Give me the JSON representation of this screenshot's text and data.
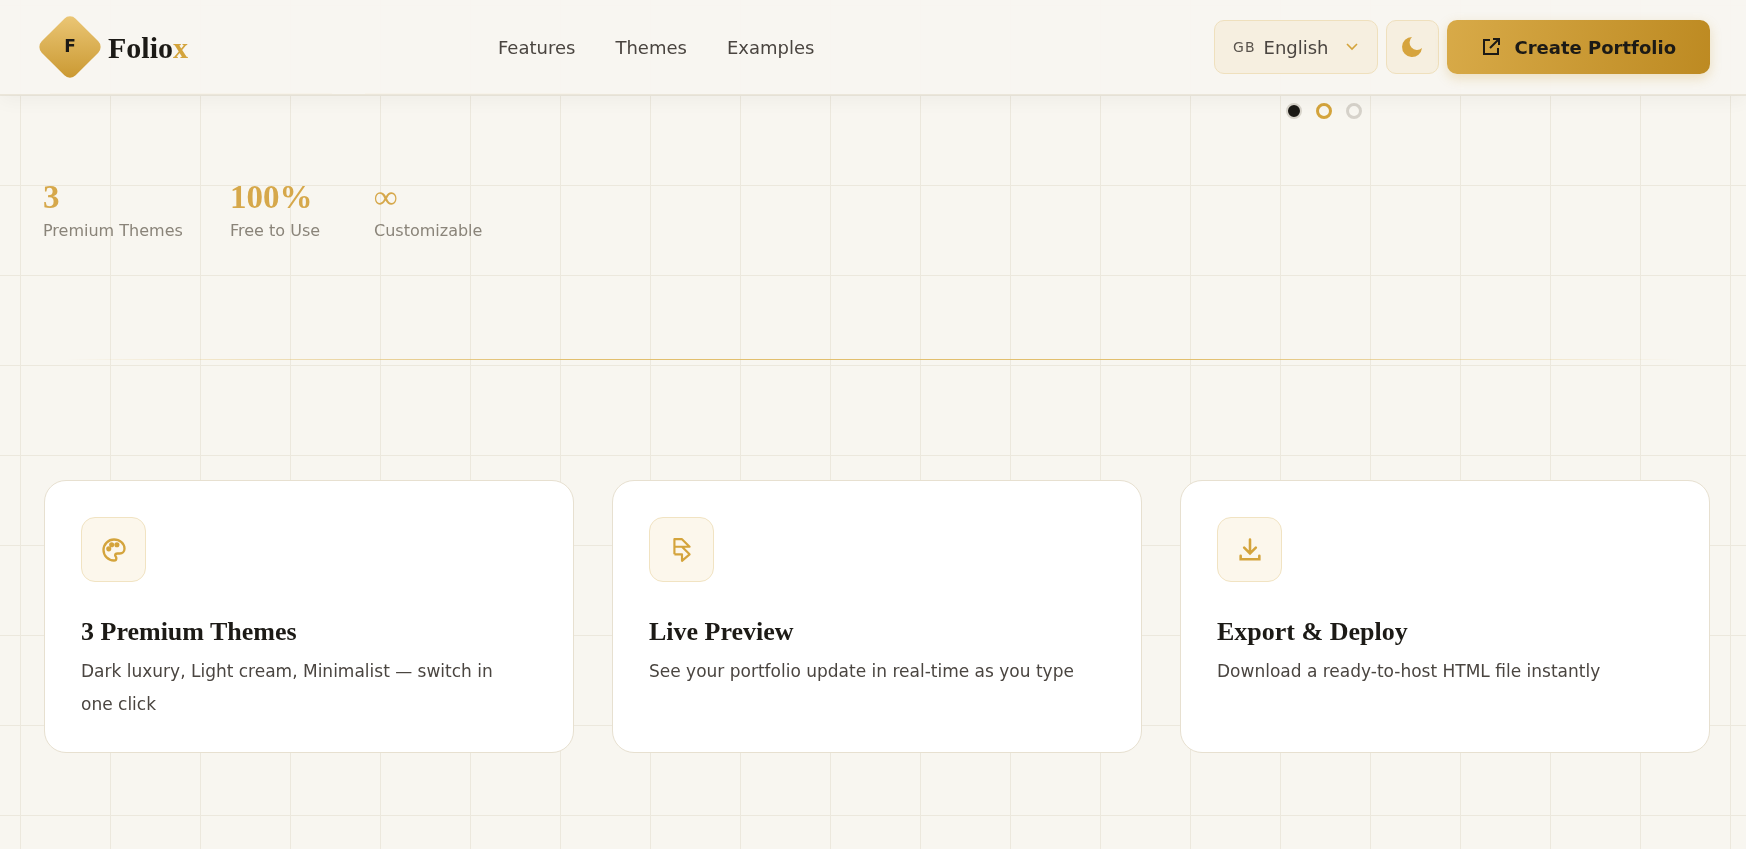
{
  "brand": {
    "badge": "F",
    "name_main": "Folio",
    "name_accent": "x"
  },
  "nav": [
    {
      "label": "Features"
    },
    {
      "label": "Themes"
    },
    {
      "label": "Examples"
    }
  ],
  "language": {
    "code": "GB",
    "label": "English"
  },
  "create_button": {
    "label": "Create Portfolio"
  },
  "carousel_dots": [
    {
      "kind": "active"
    },
    {
      "kind": "hover"
    },
    {
      "kind": "idle"
    }
  ],
  "stats": [
    {
      "value": "3",
      "label": "Premium Themes"
    },
    {
      "value": "100%",
      "label": "Free to Use"
    },
    {
      "value": "∞",
      "label": "Customizable"
    }
  ],
  "features": [
    {
      "kind": "palette",
      "title": "3 Premium Themes",
      "description": "Dark luxury, Light cream, Minimalist — switch in one click"
    },
    {
      "kind": "framer",
      "title": "Live Preview",
      "description": "See your portfolio update in real-time as you type"
    },
    {
      "kind": "download",
      "title": "Export & Deploy",
      "description": "Download a ready-to-host HTML file instantly"
    }
  ]
}
